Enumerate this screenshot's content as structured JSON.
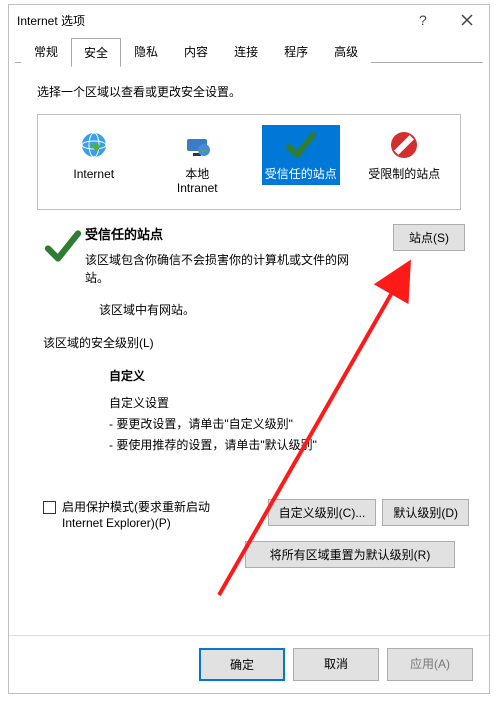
{
  "window": {
    "title": "Internet 选项"
  },
  "tabs": [
    "常规",
    "安全",
    "隐私",
    "内容",
    "连接",
    "程序",
    "高级"
  ],
  "active_tab_index": 1,
  "security": {
    "instruction": "选择一个区域以查看或更改安全设置。",
    "zones": [
      {
        "label": "Internet"
      },
      {
        "label": "本地\nIntranet"
      },
      {
        "label": "受信任的站点"
      },
      {
        "label": "受限制的站点"
      }
    ],
    "selected_zone_index": 2,
    "selected_title": "受信任的站点",
    "selected_desc": "该区域包含你确信不会损害你的计算机或文件的网站。",
    "selected_note": "该区域中有网站。",
    "sites_button": "站点(S)",
    "level_group_label": "该区域的安全级别(L)",
    "custom": {
      "title": "自定义",
      "line1": "自定义设置",
      "line2": "- 要更改设置，请单击\"自定义级别\"",
      "line3": "- 要使用推荐的设置，请单击\"默认级别\""
    },
    "protected_mode": "启用保护模式(要求重新启动 Internet Explorer)(P)",
    "custom_level_btn": "自定义级别(C)...",
    "default_level_btn": "默认级别(D)",
    "reset_btn": "将所有区域重置为默认级别(R)"
  },
  "buttons": {
    "ok": "确定",
    "cancel": "取消",
    "apply": "应用(A)"
  }
}
